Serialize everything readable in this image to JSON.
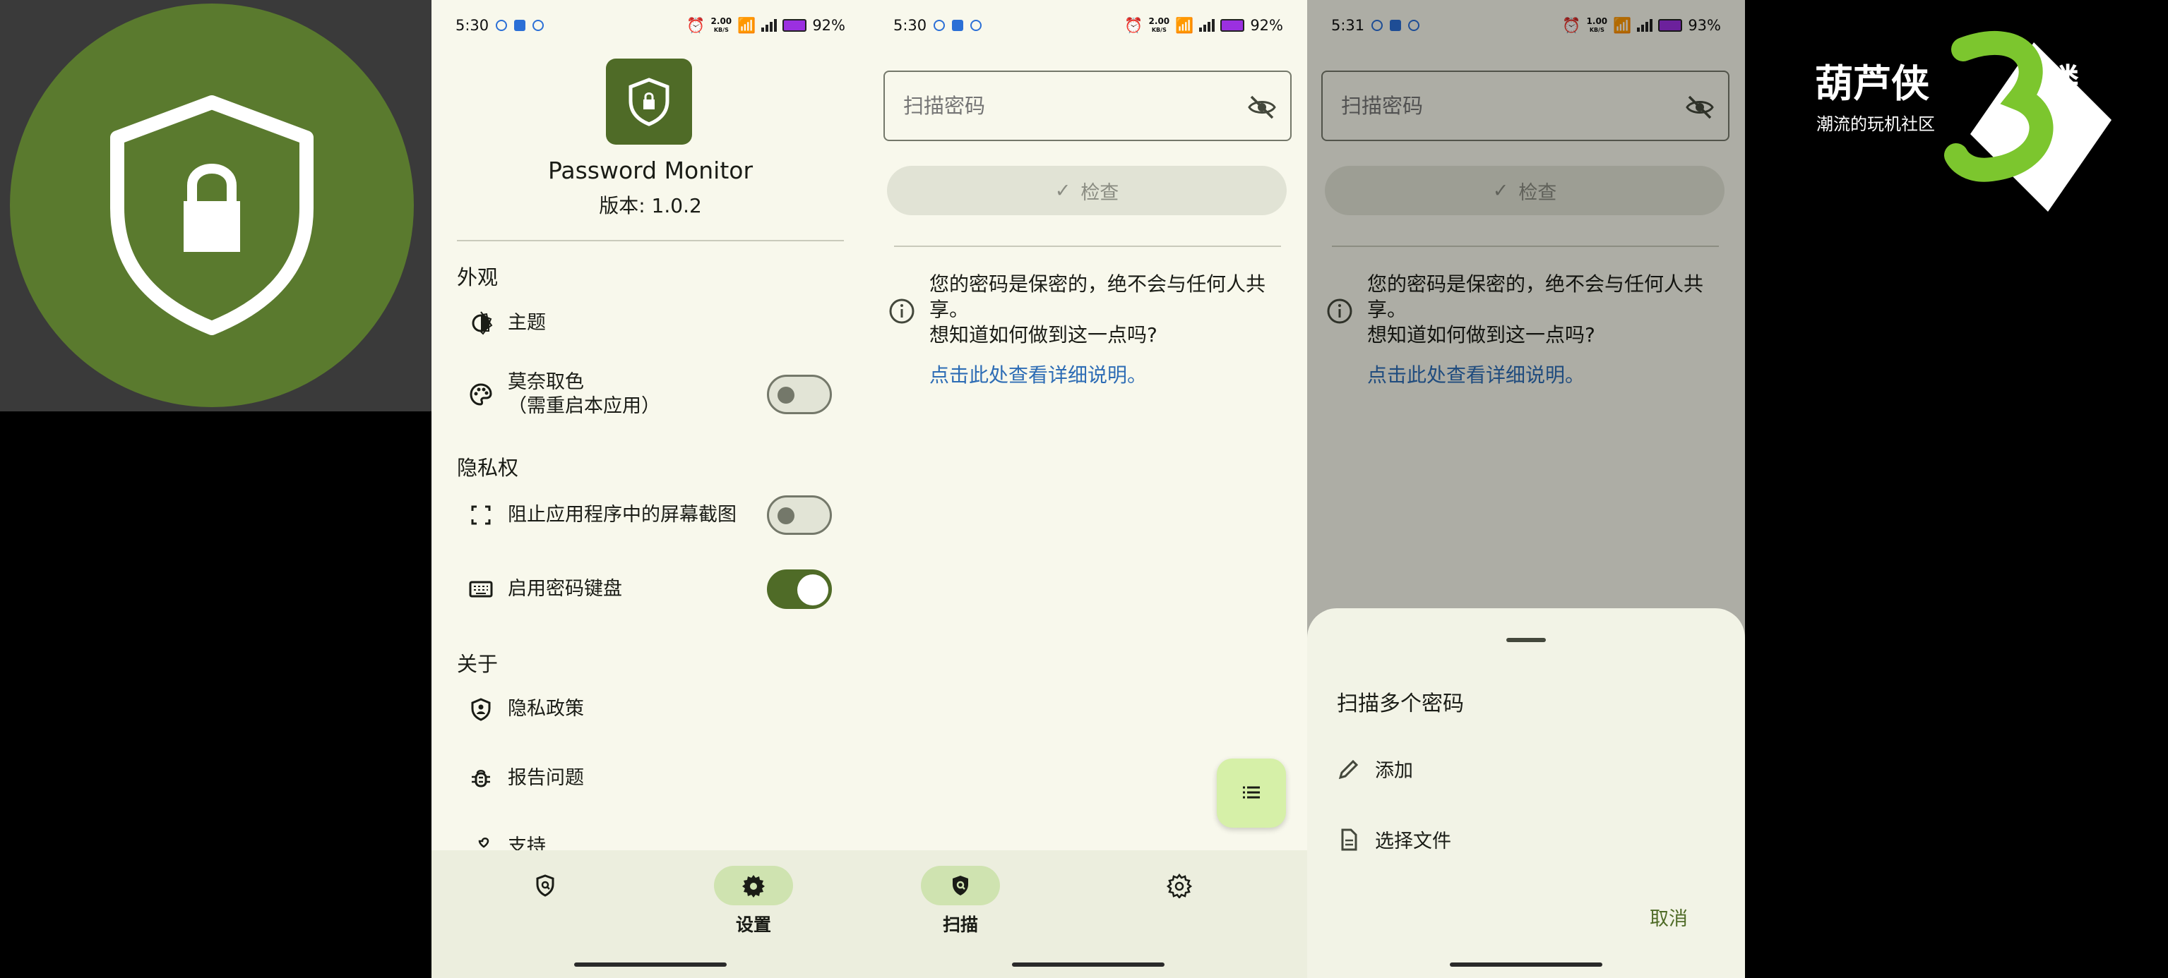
{
  "status": {
    "phone1_time": "5:30",
    "phone2_time": "5:30",
    "phone3_time": "5:31",
    "net_speed_1": "2.00",
    "net_speed_2": "2.00",
    "net_speed_3": "1.00",
    "net_unit": "KB/S",
    "battery_1": "92%",
    "battery_2": "92%",
    "battery_3": "93%"
  },
  "settings": {
    "app_name": "Password Monitor",
    "version": "版本: 1.0.2",
    "sections": {
      "appearance": "外观",
      "privacy": "隐私权",
      "about": "关于"
    },
    "items": {
      "theme": "主题",
      "monet_line1": "莫奈取色",
      "monet_line2": "（需重启本应用）",
      "block_screenshots": "阻止应用程序中的屏幕截图",
      "password_keyboard": "启用密码键盘",
      "privacy_policy": "隐私政策",
      "report_issue": "报告问题",
      "support": "支持"
    },
    "toggles": {
      "monet": false,
      "block_screenshots": false,
      "password_keyboard": true
    }
  },
  "nav": {
    "settings_label": "设置",
    "scan_label": "扫描"
  },
  "scan": {
    "input_placeholder": "扫描密码",
    "check_label": "检查",
    "info_text_1": "您的密码是保密的，绝不会与任何人共享。",
    "info_text_2": "想知道如何做到这一点吗?",
    "info_link": "点击此处查看详细说明。"
  },
  "sheet": {
    "title": "扫描多个密码",
    "add": "添加",
    "choose_file": "选择文件",
    "cancel": "取消"
  },
  "watermark": {
    "title": "葫芦侠",
    "floor": "楼",
    "subtitle": "潮流的玩机社区"
  },
  "colors": {
    "primary": "#4f6b27",
    "surface": "#f8f8ec",
    "link": "#2e6db5",
    "fab": "#d6f0a8",
    "icon_green": "#5a7a2e"
  }
}
